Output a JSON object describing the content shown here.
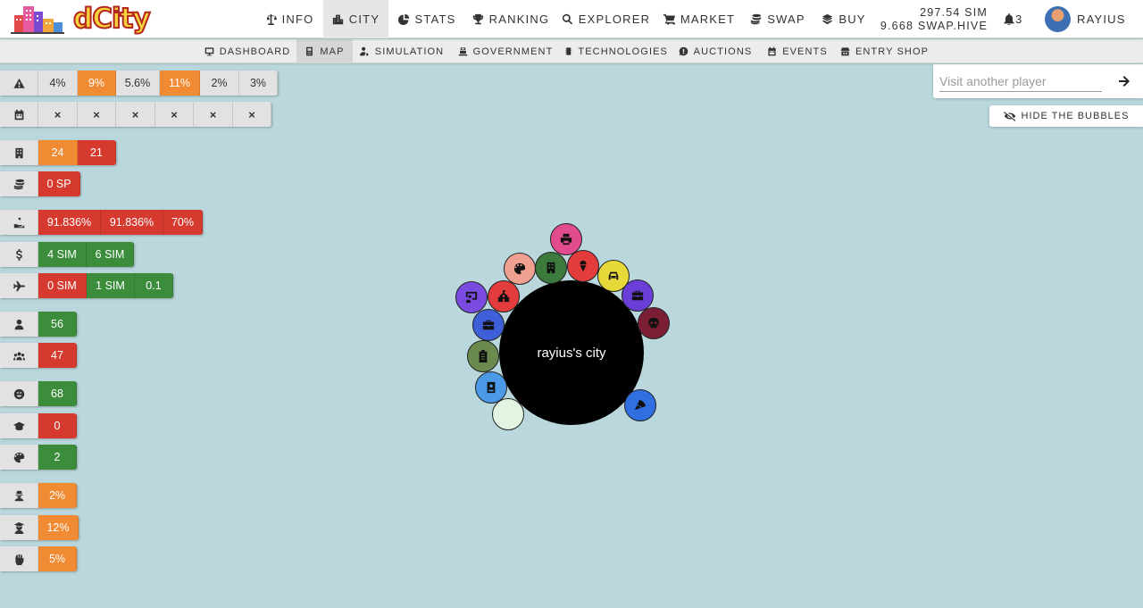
{
  "brand": {
    "logo_text": "dCity"
  },
  "header": {
    "nav": [
      {
        "label": "INFO",
        "icon": "scale-icon"
      },
      {
        "label": "CITY",
        "icon": "city-icon",
        "active": true
      },
      {
        "label": "STATS",
        "icon": "pie-chart-icon"
      },
      {
        "label": "RANKING",
        "icon": "trophy-icon"
      },
      {
        "label": "EXPLORER",
        "icon": "search-icon"
      },
      {
        "label": "MARKET",
        "icon": "cart-icon"
      },
      {
        "label": "SWAP",
        "icon": "coins-icon"
      },
      {
        "label": "BUY",
        "icon": "layers-icon"
      }
    ],
    "balance_sim": "297.54 SIM",
    "balance_swap": "9.668 SWAP.HIVE",
    "notifications": "3",
    "username": "RAYIUS"
  },
  "subnav": [
    {
      "label": "DASHBOARD",
      "icon": "monitor-icon"
    },
    {
      "label": "MAP",
      "icon": "map-icon",
      "active": true
    },
    {
      "label": "SIMULATION",
      "icon": "user-cog-icon"
    },
    {
      "label": "GOVERNMENT",
      "icon": "government-icon"
    },
    {
      "label": "TECHNOLOGIES",
      "icon": "microchip-icon"
    },
    {
      "label": "AUCTIONS",
      "icon": "auction-icon"
    },
    {
      "label": "EVENTS",
      "icon": "calendar-icon"
    },
    {
      "label": "ENTRY SHOP",
      "icon": "shop-icon"
    }
  ],
  "metrics": {
    "risk": [
      "4%",
      "9%",
      "5.6%",
      "11%",
      "2%",
      "3%"
    ],
    "calendar": [
      "×",
      "×",
      "×",
      "×",
      "×",
      "×"
    ],
    "buildings": [
      "24",
      "21"
    ],
    "staking": [
      "0 SP"
    ],
    "hands": [
      "91.836%",
      "91.836%",
      "70%"
    ],
    "income": [
      "4 SIM",
      "6 SIM"
    ],
    "travel": [
      "0 SIM",
      "1 SIM",
      "0.1"
    ],
    "population": [
      "56"
    ],
    "workers": [
      "47"
    ],
    "happiness": [
      "68"
    ],
    "education": [
      "0"
    ],
    "culture": [
      "2"
    ],
    "crime": [
      "2%"
    ],
    "students": [
      "12%"
    ],
    "unemployment": [
      "5%"
    ]
  },
  "visit": {
    "placeholder": "Visit another player"
  },
  "hide_bubbles": "HIDE THE BUBBLES",
  "map": {
    "city_name": "rayius's city"
  }
}
